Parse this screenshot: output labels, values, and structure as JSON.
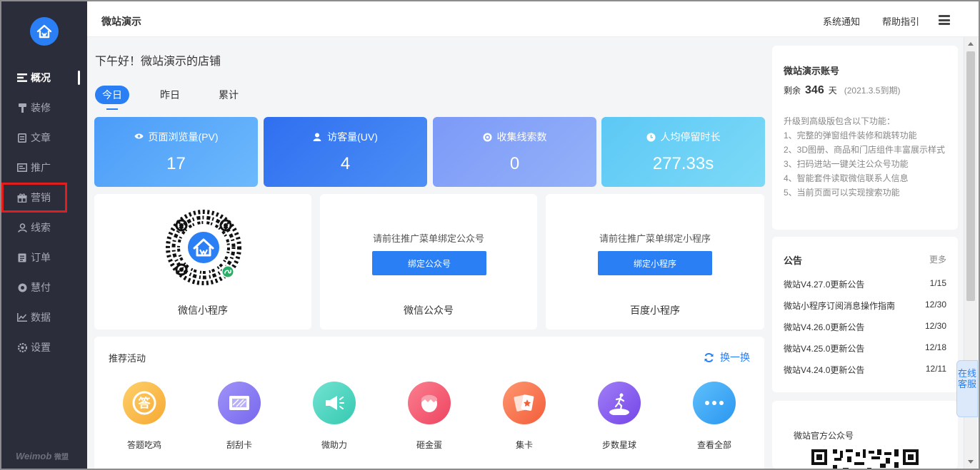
{
  "sidebar": {
    "items": [
      {
        "label": "概况",
        "icon": "overview-icon"
      },
      {
        "label": "装修",
        "icon": "decorate-icon"
      },
      {
        "label": "文章",
        "icon": "article-icon"
      },
      {
        "label": "推广",
        "icon": "promote-icon"
      },
      {
        "label": "营销",
        "icon": "marketing-icon"
      },
      {
        "label": "线索",
        "icon": "leads-icon"
      },
      {
        "label": "订单",
        "icon": "orders-icon"
      },
      {
        "label": "慧付",
        "icon": "pay-icon"
      },
      {
        "label": "数据",
        "icon": "data-icon"
      },
      {
        "label": "设置",
        "icon": "settings-icon"
      }
    ],
    "brand": "Weimob",
    "brand_cn": "微盟"
  },
  "header": {
    "title": "微站演示",
    "notice": "系统通知",
    "help": "帮助指引"
  },
  "main": {
    "greeting": "下午好！微站演示的店铺",
    "tabs": [
      "今日",
      "昨日",
      "累计"
    ],
    "stats": [
      {
        "label": "页面浏览量(PV)",
        "value": "17",
        "icon": "eye-icon",
        "color": "#5aa8fb"
      },
      {
        "label": "访客量(UV)",
        "value": "4",
        "icon": "user-icon",
        "color": "#3d7ff0"
      },
      {
        "label": "收集线索数",
        "value": "0",
        "icon": "target-icon",
        "color": "#86a6f8"
      },
      {
        "label": "人均停留时长",
        "value": "277.33s",
        "icon": "clock-icon",
        "color": "#6fd0f5"
      }
    ],
    "channels": {
      "miniprogram_label": "微信小程序",
      "wechat_label": "微信公众号",
      "wechat_prompt": "请前往推广菜单绑定公众号",
      "wechat_button": "绑定公众号",
      "baidu_label": "百度小程序",
      "baidu_prompt": "请前往推广菜单绑定小程序",
      "baidu_button": "绑定小程序"
    },
    "recommend": {
      "title": "推荐活动",
      "refresh": "换一换",
      "activities": [
        {
          "name": "答题吃鸡",
          "icon": "quiz-icon",
          "color": "#fbb740"
        },
        {
          "name": "刮刮卡",
          "icon": "scratch-card-icon",
          "color": "#8d7cf2"
        },
        {
          "name": "微助力",
          "icon": "megaphone-icon",
          "color": "#4fd6c0"
        },
        {
          "name": "砸金蛋",
          "icon": "egg-icon",
          "color": "#f5627a"
        },
        {
          "name": "集卡",
          "icon": "cards-icon",
          "color": "#f7734d"
        },
        {
          "name": "步数星球",
          "icon": "planet-icon",
          "color": "#8c62f0"
        },
        {
          "name": "查看全部",
          "icon": "more-icon",
          "color": "#39a8f5"
        }
      ]
    }
  },
  "account": {
    "title": "微站演示账号",
    "remain_prefix": "剩余",
    "days": "346",
    "days_unit": "天",
    "expiry": "(2021.3.5到期)",
    "upgrade_intro": "升级到高级版包含以下功能：",
    "features": [
      "1、完整的弹窗组件装修和跳转功能",
      "2、3D图册、商品和门店组件丰富展示样式",
      "3、扫码进站一键关注公众号功能",
      "4、智能套件读取微信联系人信息",
      "5、当前页面可以实现搜索功能"
    ]
  },
  "announcements": {
    "title": "公告",
    "more": "更多",
    "items": [
      {
        "title": "微站V4.27.0更新公告",
        "date": "1/15"
      },
      {
        "title": "微站小程序订阅消息操作指南",
        "date": "12/30"
      },
      {
        "title": "微站V4.26.0更新公告",
        "date": "12/30"
      },
      {
        "title": "微站V4.25.0更新公告",
        "date": "12/18"
      },
      {
        "title": "微站V4.24.0更新公告",
        "date": "12/11"
      }
    ]
  },
  "official": {
    "title": "微站官方公众号"
  },
  "service": {
    "label": "在线客服"
  },
  "colors": {
    "accent": "#2a7ff5",
    "sidebar": "#2b2d3a"
  }
}
